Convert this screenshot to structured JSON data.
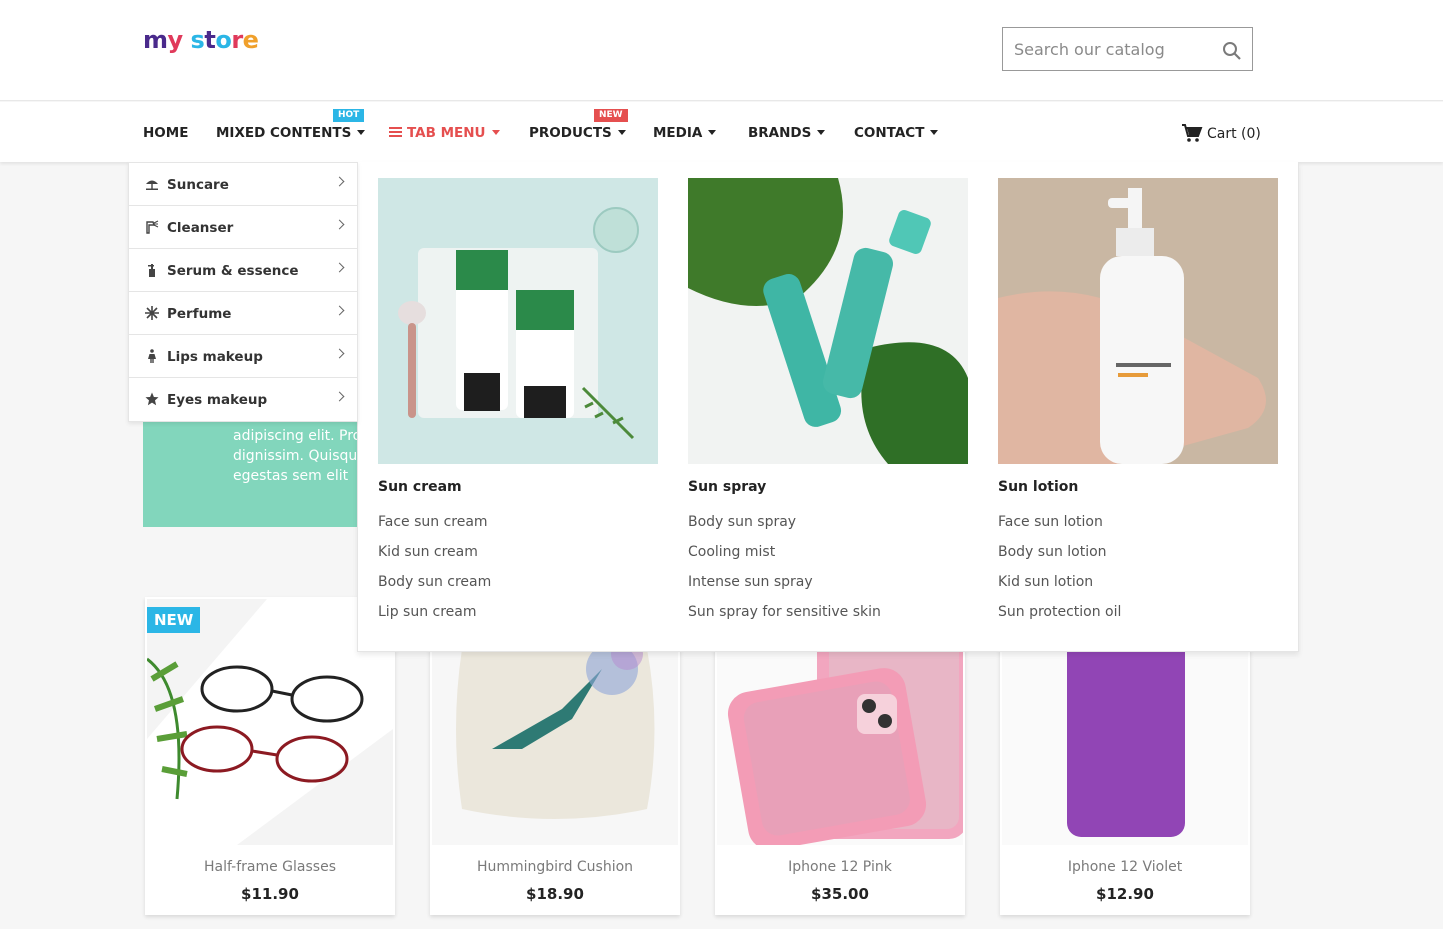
{
  "logo": {
    "text": "my store"
  },
  "search": {
    "placeholder": "Search our catalog"
  },
  "nav": {
    "home": "HOME",
    "mixed": "MIXED CONTENTS",
    "mixed_badge": "HOT",
    "tab_menu": "TAB MENU",
    "products": "PRODUCTS",
    "products_badge": "NEW",
    "media": "MEDIA",
    "brands": "BRANDS",
    "contact": "CONTACT",
    "cart": "Cart (0)"
  },
  "sidebar": {
    "items": [
      {
        "label": "Suncare",
        "icon": "umbrella-beach-icon"
      },
      {
        "label": "Cleanser",
        "icon": "spray-bottle-icon"
      },
      {
        "label": "Serum & essence",
        "icon": "dropper-bottle-icon"
      },
      {
        "label": "Perfume",
        "icon": "snowflake-icon"
      },
      {
        "label": "Lips makeup",
        "icon": "female-figure-icon"
      },
      {
        "label": "Eyes makeup",
        "icon": "star-icon"
      }
    ]
  },
  "mega": {
    "columns": [
      {
        "title": "Sun cream",
        "links": [
          "Face sun cream",
          "Kid sun cream",
          "Body sun cream",
          "Lip sun cream"
        ]
      },
      {
        "title": "Sun spray",
        "links": [
          "Body sun spray",
          "Cooling mist",
          "Intense sun spray",
          "Sun spray for sensitive skin"
        ]
      },
      {
        "title": "Sun lotion",
        "links": [
          "Face sun lotion",
          "Body sun lotion",
          "Kid sun lotion",
          "Sun protection oil"
        ]
      }
    ]
  },
  "banner": {
    "text_line1": "adipiscing elit. Pro",
    "text_line2": "dignissim. Quisqu",
    "text_line3": "egestas sem elit"
  },
  "products": [
    {
      "name": "Half-frame Glasses",
      "price": "$11.90",
      "flag": "NEW"
    },
    {
      "name": "Hummingbird Cushion",
      "price": "$18.90"
    },
    {
      "name": "Iphone 12 Pink",
      "price": "$35.00"
    },
    {
      "name": "Iphone 12 Violet",
      "price": "$12.90"
    }
  ],
  "colors": {
    "accent": "#e54f4f",
    "hot_badge": "#2bb6e6",
    "banner_green": "#82d6bc"
  }
}
